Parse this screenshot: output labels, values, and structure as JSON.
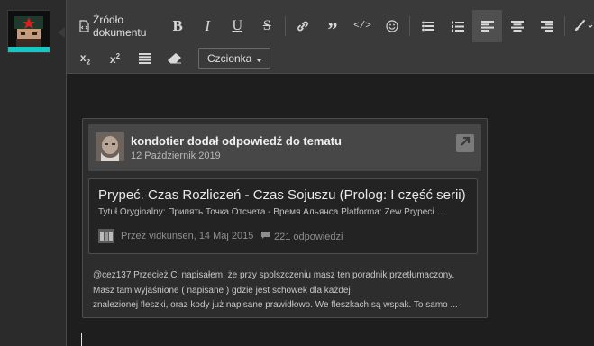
{
  "toolbar": {
    "source_label": "Źródło dokumentu",
    "font_select_value": "Czcionka",
    "buttons_row1": [
      "source-icon",
      "bold-icon",
      "italic-icon",
      "underline-icon",
      "strikethrough-icon",
      "link-icon",
      "quote-icon",
      "code-icon",
      "emoji-icon",
      "bulleted-list-icon",
      "numbered-list-icon",
      "align-left-icon",
      "align-center-icon",
      "align-right-icon",
      "brush-icon"
    ],
    "buttons_row2": [
      "subscript-icon",
      "superscript-icon",
      "justify-icon",
      "eraser-icon"
    ],
    "active_button": "align-left-icon"
  },
  "quote": {
    "header_text": "kondotier dodał odpowiedź do tematu",
    "date": "12 Październik 2019",
    "topic": {
      "title": "Prypeć. Czas Rozliczeń - Czas Sojuszu (Prolog: I część serii)",
      "subtitle": "Tytuł Oryginalny: Припять Точка Отсчета - Время Альянса Platforma: Zew Prypeci ...",
      "meta": "Przez vidkunsen, 14 Maj 2015",
      "replies": "221 odpowiedzi"
    },
    "body_lines": [
      "@cez137  Przecież Ci napisałem, że przy spolszczeniu masz ten poradnik przetłumaczony.",
      "Masz tam wyjaśnione ( napisane ) gdzie jest schowek dla każdej",
      "znalezionej fleszki, oraz kody już napisane prawidłowo. We fleszkach są wspak. To samo ..."
    ]
  },
  "colors": {
    "toolbar_bg": "#3a3a3a",
    "editor_bg": "#1e1e1e",
    "card_bg": "#2d2d2d",
    "header_bg": "#474747",
    "avatar_star": "#d62020"
  }
}
